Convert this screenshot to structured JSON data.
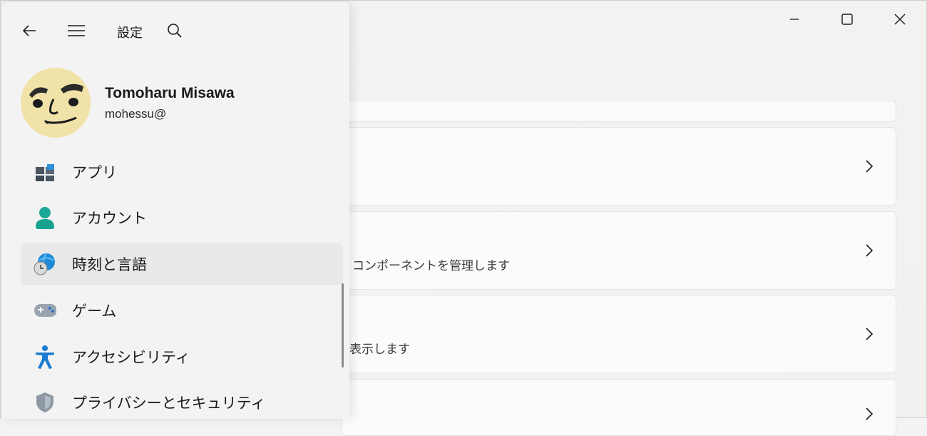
{
  "app": {
    "title": "設定"
  },
  "profile": {
    "name": "Tomoharu Misawa",
    "email": "mohessu@"
  },
  "menu": {
    "items": [
      {
        "label": "アプリ",
        "icon": "apps-icon"
      },
      {
        "label": "アカウント",
        "icon": "account-icon"
      },
      {
        "label": "時刻と言語",
        "icon": "time-language-icon",
        "selected": true
      },
      {
        "label": "ゲーム",
        "icon": "gaming-icon"
      },
      {
        "label": "アクセシビリティ",
        "icon": "accessibility-icon"
      },
      {
        "label": "プライバシーとセキュリティ",
        "icon": "privacy-shield-icon"
      }
    ]
  },
  "content": {
    "card2_desc": "コンポーネントを管理します",
    "card3_desc": "表示します"
  },
  "colors": {
    "accent": "#0078d4",
    "selected_bg": "#e9e9e9"
  }
}
